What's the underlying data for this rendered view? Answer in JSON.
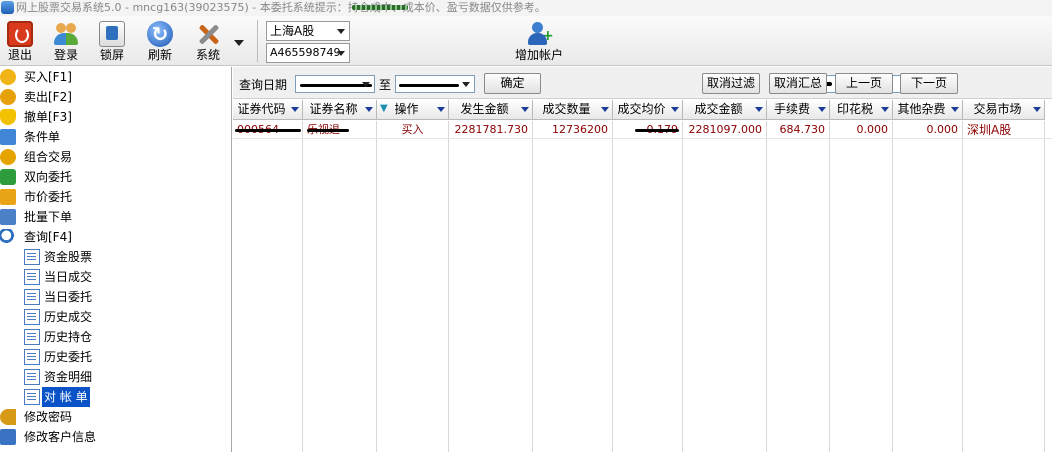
{
  "title_bar": {
    "text": "网上股票交易系统5.0 - mncg163(39023575) - 本委托系统提示：持仓成本、成本价、盈亏数据仅供参考。"
  },
  "toolbar": {
    "buttons": [
      {
        "label": "退出",
        "icon": "exit-icon"
      },
      {
        "label": "登录",
        "icon": "login-icon"
      },
      {
        "label": "锁屏",
        "icon": "lock-screen-icon"
      },
      {
        "label": "刷新",
        "icon": "refresh-icon"
      },
      {
        "label": "系统",
        "icon": "system-tools-icon"
      }
    ],
    "market": "上海A股",
    "account": "A465598749",
    "add_account": "增加帐户"
  },
  "tree": {
    "items": [
      {
        "label": "买入[F1]",
        "icon": "buy-icon"
      },
      {
        "label": "卖出[F2]",
        "icon": "sell-icon"
      },
      {
        "label": "撤单[F3]",
        "icon": "cancel-order-icon"
      },
      {
        "label": "条件单",
        "icon": "condition-order-icon"
      },
      {
        "label": "组合交易",
        "icon": "combo-trade-icon"
      },
      {
        "label": "双向委托",
        "icon": "two-way-order-icon"
      },
      {
        "label": "市价委托",
        "icon": "market-order-icon"
      },
      {
        "label": "批量下单",
        "icon": "batch-order-icon"
      },
      {
        "label": "查询[F4]",
        "icon": "query-icon"
      }
    ],
    "query_children": [
      "资金股票",
      "当日成交",
      "当日委托",
      "历史成交",
      "历史持仓",
      "历史委托",
      "资金明细",
      "对 帐 单"
    ],
    "bottom_items": [
      {
        "label": "修改密码",
        "icon": "key-icon"
      },
      {
        "label": "修改客户信息",
        "icon": "client-info-icon"
      }
    ]
  },
  "filter": {
    "date_label": "查询日期",
    "to_label": "至",
    "confirm": "确定",
    "code_value": "000564",
    "cancel_filter": "取消过滤",
    "cancel_summary": "取消汇总",
    "prev_page": "上一页",
    "next_page": "下一页"
  },
  "table": {
    "columns": [
      "证券代码",
      "证券名称",
      "操作",
      "发生金额",
      "成交数量",
      "成交均价",
      "成交金额",
      "手续费",
      "印花税",
      "其他杂费",
      "交易市场"
    ],
    "rows": [
      {
        "code": "000564",
        "name": "乐视退",
        "op": "买入",
        "amount": "2281781.730",
        "qty": "12736200",
        "avg_price": "0.179",
        "deal_amount": "2281097.000",
        "commission": "684.730",
        "stamp_tax": "0.000",
        "other_fees": "0.000",
        "market": "深圳A股"
      }
    ]
  }
}
